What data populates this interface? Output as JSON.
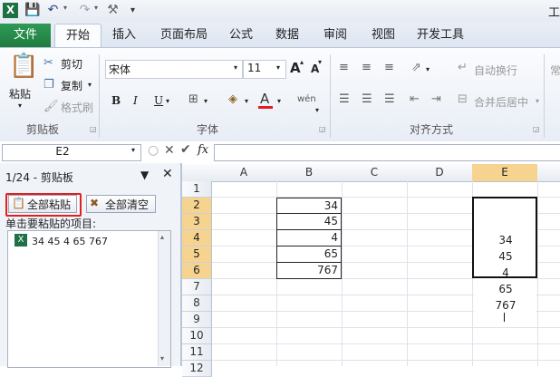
{
  "titlebar": {
    "app_logo": "X",
    "window_title": "工"
  },
  "tabs": {
    "file": "文件",
    "items": [
      "开始",
      "插入",
      "页面布局",
      "公式",
      "数据",
      "审阅",
      "视图",
      "开发工具"
    ]
  },
  "ribbon": {
    "clipboard": {
      "paste": "粘贴",
      "cut": "剪切",
      "copy": "复制",
      "format_painter": "格式刷",
      "group_label": "剪贴板"
    },
    "font": {
      "font_name": "宋体",
      "font_size": "11",
      "bold": "B",
      "italic": "I",
      "underline": "U",
      "grow": "A",
      "shrink": "A",
      "font_color": "A",
      "phonetic": "wén",
      "group_label": "字体"
    },
    "alignment": {
      "wrap_text": "自动换行",
      "merge_center": "合并后居中",
      "group_label": "对齐方式",
      "number_partial": "常"
    }
  },
  "formula_bar": {
    "name_box": "E2",
    "fx": "fx"
  },
  "clipboard_pane": {
    "title": "1/24 - 剪贴板",
    "paste_all": "全部粘贴",
    "clear_all": "全部清空",
    "hint": "单击要粘贴的项目:",
    "items": [
      {
        "text": "34 45 4 65 767"
      }
    ]
  },
  "sheet": {
    "columns": [
      "A",
      "B",
      "C",
      "D",
      "E"
    ],
    "rows": [
      "1",
      "2",
      "3",
      "4",
      "5",
      "6",
      "7",
      "8",
      "9",
      "10",
      "11",
      "12"
    ],
    "selected_column": "E",
    "selected_rows": [
      "2",
      "3",
      "4",
      "5",
      "6"
    ],
    "column_b_values": [
      "34",
      "45",
      "4",
      "65",
      "767"
    ],
    "column_e_values": [
      "34",
      "45",
      "4",
      "65",
      "767"
    ]
  },
  "colors": {
    "file_tab": "#1e7c40",
    "selection_header": "#f6d48f",
    "highlight_border": "#e02020",
    "font_color_bar": "#e02020"
  }
}
